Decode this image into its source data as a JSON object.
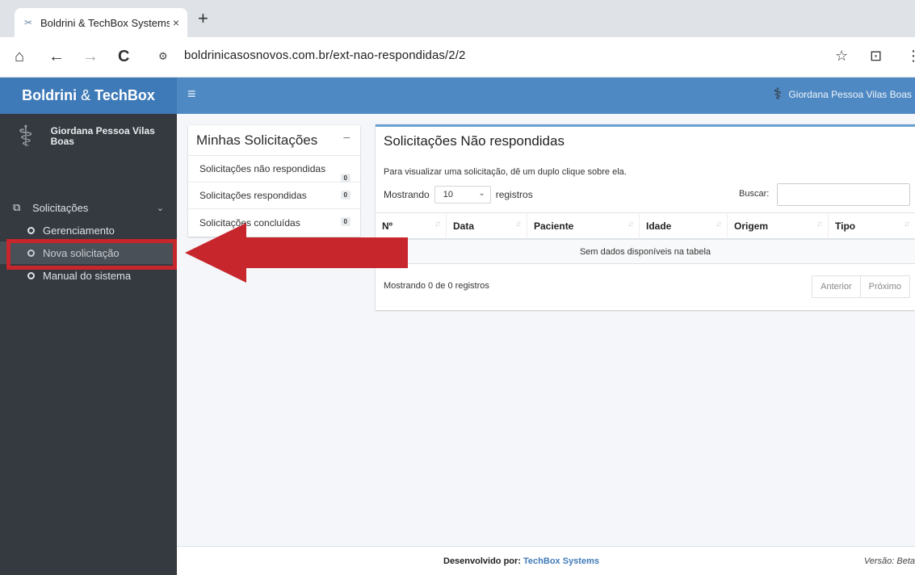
{
  "browser": {
    "tab_title": "Boldrini & TechBox Systems",
    "tab_close": "×",
    "new_tab": "+",
    "url": "boldrinicasosnovos.com.br/ext-nao-respondidas/2/2",
    "site_info": "⚙",
    "back": "←",
    "forward": "→",
    "reload": "C",
    "home": "⌂",
    "star": "☆",
    "ext": "⊡",
    "menu": "⋮"
  },
  "header": {
    "brand_left": "Boldrini",
    "brand_amp": "&",
    "brand_right": "TechBox",
    "hamburger": "≡",
    "user_name": "Giordana Pessoa Vilas Boas"
  },
  "sidebar": {
    "user_name": "Giordana Pessoa Vilas Boas",
    "menu_group": "Solicitações",
    "items": [
      {
        "label": "Gerenciamento"
      },
      {
        "label": "Nova solicitação"
      },
      {
        "label": "Manual do sistema"
      }
    ]
  },
  "left_card": {
    "title": "Minhas Solicitações",
    "collapse": "−",
    "items": [
      {
        "label": "Solicitações não respondidas",
        "count": "0"
      },
      {
        "label": "Solicitações respondidas",
        "count": "0"
      },
      {
        "label": "Solicitações concluídas",
        "count": "0"
      }
    ]
  },
  "main_card": {
    "title": "Solicitações Não respondidas",
    "hint": "Para visualizar uma solicitação, dê um duplo clique sobre ela.",
    "show_prefix": "Mostrando",
    "page_size": "10",
    "show_suffix": "registros",
    "search_label": "Buscar:",
    "search_value": "",
    "columns": [
      "Nº",
      "Data",
      "Paciente",
      "Idade",
      "Origem",
      "Tipo"
    ],
    "empty_text": "Sem dados disponíveis na tabela",
    "footer_text": "Mostrando 0 de 0 registros",
    "prev": "Anterior",
    "next": "Próximo"
  },
  "footer": {
    "dev_label": "Desenvolvido por:",
    "dev_link": "TechBox Systems",
    "version": "Versão: Beta"
  },
  "colors": {
    "header": "#4e89c4",
    "sidebar": "#343a40",
    "annotation": "#c6262c"
  }
}
